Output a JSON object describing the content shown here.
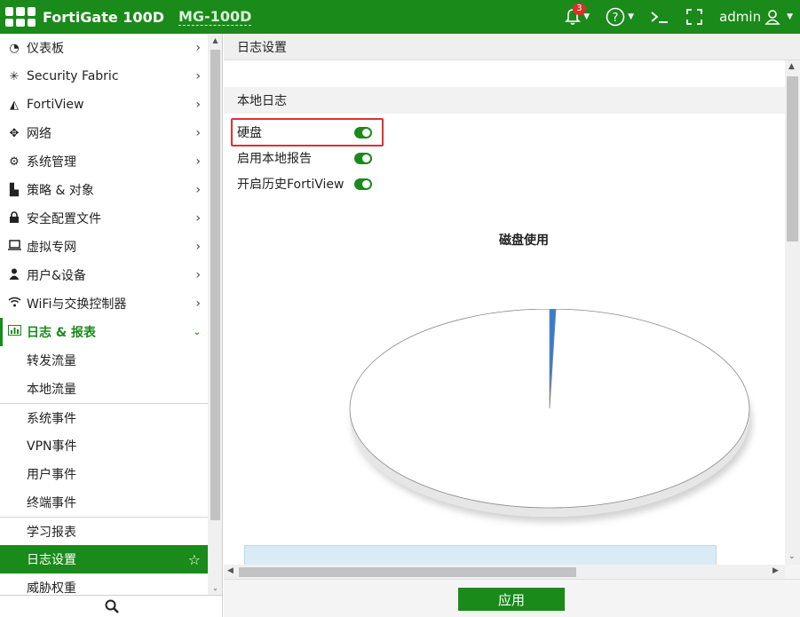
{
  "topbar": {
    "brand": "FortiGate 100D",
    "hostname": "MG-100D",
    "notification_count": "3",
    "user": "admin",
    "icons": [
      "bell-icon",
      "help-icon",
      "cli-console-icon",
      "fullscreen-icon",
      "user-icon"
    ]
  },
  "sidebar": {
    "items": [
      {
        "label": "仪表板",
        "icon": "dashboard-icon"
      },
      {
        "label": "Security Fabric",
        "icon": "security-fabric-icon"
      },
      {
        "label": "FortiView",
        "icon": "fortiview-icon"
      },
      {
        "label": "网络",
        "icon": "network-icon"
      },
      {
        "label": "系统管理",
        "icon": "gear-icon"
      },
      {
        "label": "策略 & 对象",
        "icon": "policy-icon"
      },
      {
        "label": "安全配置文件",
        "icon": "lock-icon"
      },
      {
        "label": "虚拟专网",
        "icon": "vpn-icon"
      },
      {
        "label": "用户&设备",
        "icon": "user-icon"
      },
      {
        "label": "WiFi与交换控制器",
        "icon": "wifi-icon"
      }
    ],
    "active_section": {
      "label": "日志 & 报表",
      "icon": "log-report-icon"
    },
    "sub_items": [
      {
        "label": "转发流量"
      },
      {
        "label": "本地流量"
      },
      {
        "label": "系统事件"
      },
      {
        "label": "VPN事件"
      },
      {
        "label": "用户事件"
      },
      {
        "label": "终端事件"
      },
      {
        "label": "学习报表"
      },
      {
        "label": "日志设置"
      },
      {
        "label": "威胁权重"
      }
    ],
    "selected_sub_item": "日志设置"
  },
  "main": {
    "page_title": "日志设置",
    "section_title": "本地日志",
    "toggles": [
      {
        "label": "硬盘",
        "state": "on"
      },
      {
        "label": "启用本地报告",
        "state": "on"
      },
      {
        "label": "开启历史FortiView",
        "state": "on"
      }
    ],
    "apply_label": "应用"
  },
  "chart_data": {
    "type": "pie",
    "title": "磁盘使用",
    "slices": [
      {
        "value": 0.5,
        "color": "#2f7ed8"
      },
      {
        "value": 99.5,
        "color": "#ffffff"
      }
    ]
  }
}
